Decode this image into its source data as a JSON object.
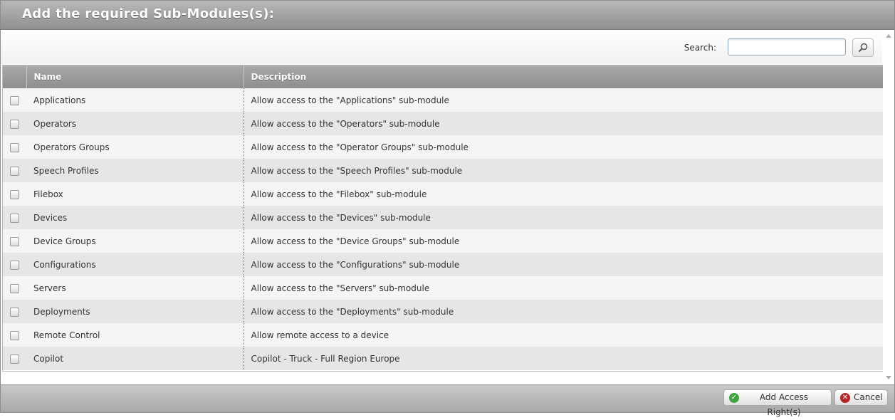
{
  "dialog": {
    "title": "Add the required Sub-Modules(s):"
  },
  "search": {
    "label": "Search:",
    "value": "",
    "placeholder": "",
    "icon": "magnifier-icon"
  },
  "table": {
    "columns": {
      "name": "Name",
      "description": "Description"
    },
    "rows": [
      {
        "name": "Applications",
        "description": "Allow access to the \"Applications\" sub-module"
      },
      {
        "name": "Operators",
        "description": "Allow access to the \"Operators\" sub-module"
      },
      {
        "name": "Operators Groups",
        "description": "Allow access to the \"Operator Groups\" sub-module"
      },
      {
        "name": "Speech Profiles",
        "description": "Allow access to the \"Speech Profiles\" sub-module"
      },
      {
        "name": "Filebox",
        "description": "Allow access to the \"Filebox\" sub-module"
      },
      {
        "name": "Devices",
        "description": "Allow access to the \"Devices\" sub-module"
      },
      {
        "name": "Device Groups",
        "description": "Allow access to the \"Device Groups\" sub-module"
      },
      {
        "name": "Configurations",
        "description": "Allow access to the \"Configurations\" sub-module"
      },
      {
        "name": "Servers",
        "description": "Allow access to the \"Servers\" sub-module"
      },
      {
        "name": "Deployments",
        "description": "Allow access to the \"Deployments\" sub-module"
      },
      {
        "name": "Remote Control",
        "description": "Allow remote access to a device"
      },
      {
        "name": "Copilot",
        "description": "Copilot - Truck - Full Region Europe"
      }
    ]
  },
  "footer": {
    "add_label": "Add Access Right(s)",
    "cancel_label": "Cancel",
    "add_icon": "check-icon",
    "cancel_icon": "close-icon",
    "add_icon_color": "#3fa33f",
    "cancel_icon_color": "#b52525"
  }
}
